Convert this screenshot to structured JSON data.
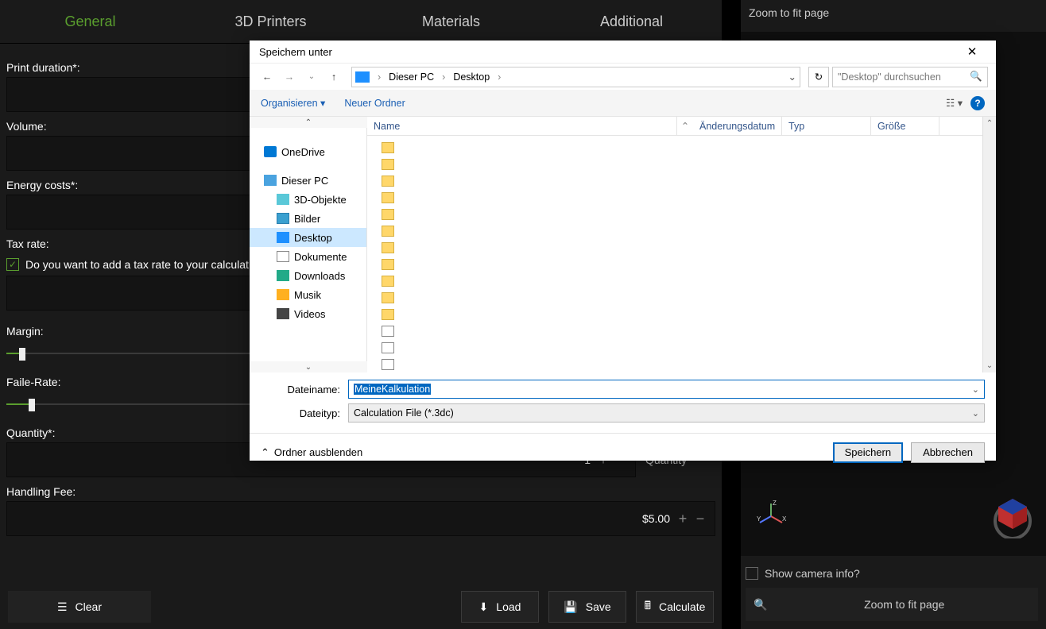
{
  "tabs": {
    "general": "General",
    "printers": "3D Printers",
    "materials": "Materials",
    "additional": "Additional"
  },
  "form": {
    "print_duration_label": "Print duration*:",
    "volume_label": "Volume:",
    "energy_label": "Energy costs*:",
    "taxrate_label": "Tax rate:",
    "tax_checkbox": "Do you want to add a tax rate to your calculat",
    "margin_label": "Margin:",
    "faile_label": "Faile-Rate:",
    "quantity_label": "Quantity*:",
    "quantity_value": "1",
    "quantity_side": "Quantity",
    "handling_label": "Handling Fee:",
    "handling_value": "$5.00"
  },
  "buttons": {
    "clear": "Clear",
    "load": "Load",
    "save": "Save",
    "calculate": "Calculate"
  },
  "right": {
    "zoom_top": "Zoom to fit page",
    "camera": "Show camera info?",
    "zoom_btn": "Zoom to fit page",
    "axis_x": "X",
    "axis_y": "Y",
    "axis_z": "Z"
  },
  "dialog": {
    "title": "Speichern unter",
    "breadcrumb": {
      "pc": "Dieser PC",
      "desktop": "Desktop"
    },
    "search_placeholder": "\"Desktop\" durchsuchen",
    "organize": "Organisieren",
    "new_folder": "Neuer Ordner",
    "tree": {
      "onedrive": "OneDrive",
      "pc": "Dieser PC",
      "objects3d": "3D-Objekte",
      "pictures": "Bilder",
      "desktop": "Desktop",
      "documents": "Dokumente",
      "downloads": "Downloads",
      "music": "Musik",
      "videos": "Videos"
    },
    "columns": {
      "name": "Name",
      "date": "Änderungsdatum",
      "type": "Typ",
      "size": "Größe"
    },
    "filename_label": "Dateiname:",
    "filename_value": "MeineKalkulation",
    "filetype_label": "Dateityp:",
    "filetype_value": "Calculation File (*.3dc)",
    "hide_folders": "Ordner ausblenden",
    "save": "Speichern",
    "cancel": "Abbrechen"
  }
}
